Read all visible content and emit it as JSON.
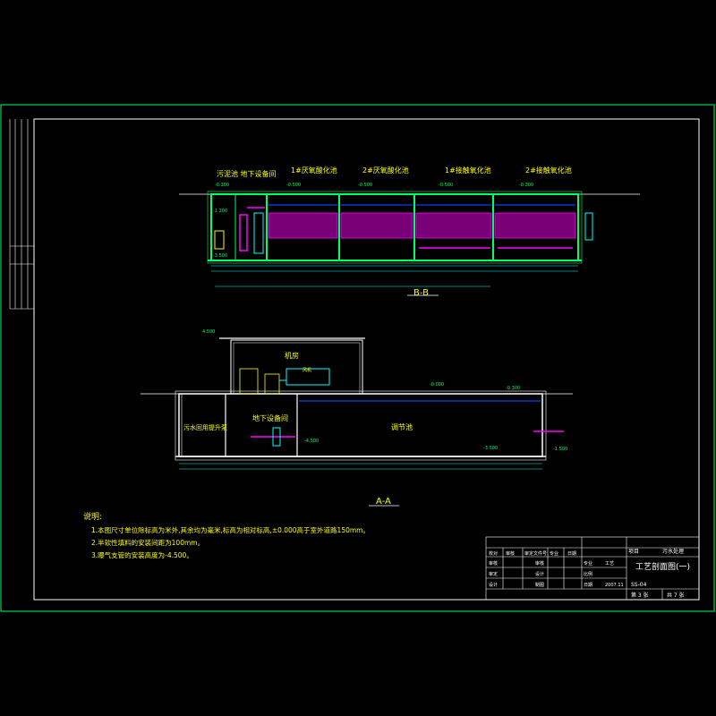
{
  "titles": {
    "bb_labels": [
      "污泥池 地下设备间",
      "1#厌氧酸化池",
      "2#厌氧酸化池",
      "1#接触氧化池",
      "2#接触氧化池"
    ],
    "bb_section": "B-B",
    "aa_section": "A-A",
    "machine_room": "机房",
    "underground_room": "地下设备间",
    "adjust_tank": "调节池",
    "collect_well": "污水回用提升泵",
    "blower": "风机"
  },
  "elevations": {
    "top_aa": "4.500",
    "ground_aa": "-0.000",
    "right_aa": "-0.300",
    "mid_aa": "-3.500",
    "bottom_aa": "-4.500",
    "small_right_aa": "-1.500",
    "bb_1": "-0.300",
    "bb_2": "-0.500",
    "bb_3": "-0.500",
    "bb_4": "-0.500",
    "bb_5": "-0.300",
    "bb_left": "-1.200",
    "bb_bottom_left": "-3.500"
  },
  "notes": {
    "heading": "说明:",
    "items": [
      "1.本图尺寸单位除标高为米外,其余均为毫米,标高为相对标高,±0.000高于室外道路150mm。",
      "2.半软性填料的安装间距为100mm。",
      "3.曝气支管的安装高度为-4.500。"
    ]
  },
  "title_block": {
    "drawing_title": "工艺剖面图(一)",
    "project_label": "项目",
    "project_value": "污水处理",
    "rows": [
      [
        "校对",
        "审核",
        "审定文件号",
        "专业",
        "日期"
      ],
      [
        "审核",
        "",
        "审核",
        "专业",
        "工艺"
      ],
      [
        "审定",
        "",
        "设计",
        "比例",
        ""
      ],
      [
        "设计",
        "",
        "制图",
        "日期",
        "2007.11"
      ]
    ],
    "drawing_no": "SS-04",
    "sheet": "第 3 张",
    "total": "共 7 张"
  },
  "colors": {
    "frame": "#00ff66",
    "label_yellow": "#ffff00",
    "water_blue": "#0044ff",
    "media_magenta": "#ff00ff",
    "dim_cyan": "#00ffff",
    "line_white": "#ffffff"
  }
}
